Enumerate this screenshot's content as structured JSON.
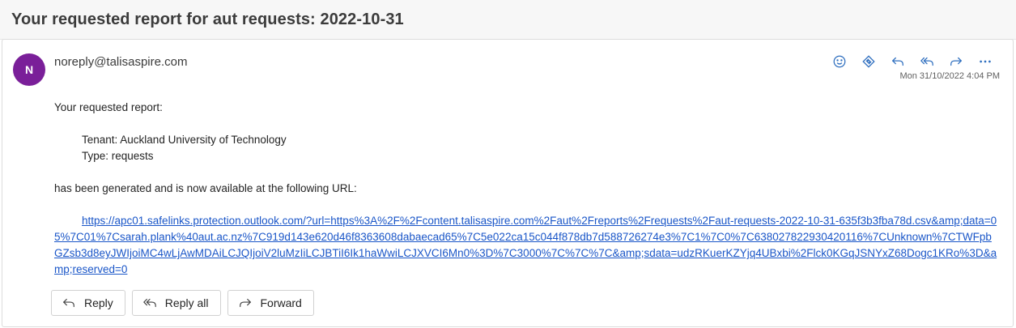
{
  "subject": "Your requested report for aut requests: 2022-10-31",
  "sender": {
    "avatar_initial": "N",
    "avatar_color": "#7a1f99",
    "address": "noreply@talisaspire.com"
  },
  "timestamp": "Mon 31/10/2022 4:04 PM",
  "toolbar_icons": [
    "emoji-icon",
    "loop-icon",
    "reply-icon",
    "reply-all-icon",
    "forward-icon",
    "more-icon"
  ],
  "body": {
    "intro": "Your requested report:",
    "tenant": "Tenant: Auckland University of Technology",
    "type": "Type: requests",
    "generated": "has been generated and is now available at the following URL:",
    "url": "https://apc01.safelinks.protection.outlook.com/?url=https%3A%2F%2Fcontent.talisaspire.com%2Faut%2Freports%2Frequests%2Faut-requests-2022-10-31-635f3b3fba78d.csv&amp;data=05%7C01%7Csarah.plank%40aut.ac.nz%7C919d143e620d46f8363608dabaecad65%7C5e022ca15c044f878db7d588726274e3%7C1%7C0%7C638027822930420116%7CUnknown%7CTWFpbGZsb3d8eyJWIjoiMC4wLjAwMDAiLCJQIjoiV2luMzIiLCJBTiI6Ik1haWwiLCJXVCI6Mn0%3D%7C3000%7C%7C%7C&amp;sdata=udzRKuerKZYjq4UBxbi%2Flck0KGqJSNYxZ68Dogc1KRo%3D&amp;reserved=0"
  },
  "reply_buttons": {
    "reply": "Reply",
    "reply_all": "Reply all",
    "forward": "Forward"
  },
  "colors": {
    "accent": "#1a56c8",
    "icon": "#2f6fbf"
  }
}
